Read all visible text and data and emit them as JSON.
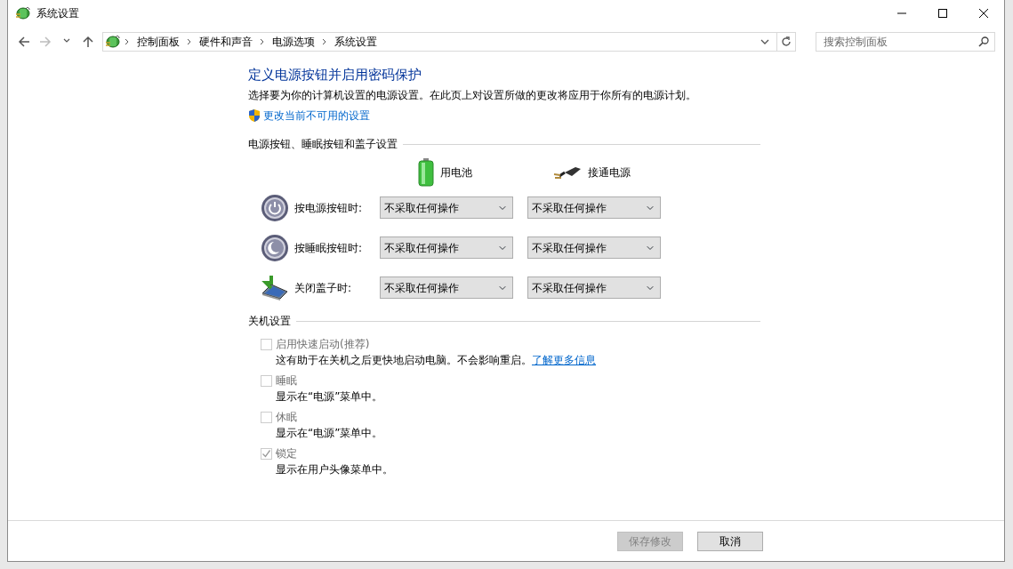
{
  "window": {
    "title": "系统设置"
  },
  "navigation": [
    {
      "kind": "back",
      "disabled": false
    },
    {
      "kind": "forward",
      "disabled": true
    },
    {
      "kind": "recent",
      "disabled": false
    },
    {
      "kind": "up",
      "disabled": false
    }
  ],
  "address_bar": {
    "path": [
      "控制面板",
      "硬件和声音",
      "电源选项",
      "系统设置"
    ]
  },
  "search": {
    "placeholder": "搜索控制面板"
  },
  "heading": "定义电源按钮并启用密码保护",
  "description": "选择要为你的计算机设置的电源设置。在此页上对设置所做的更改将应用于你所有的电源计划。",
  "admin_link": "更改当前不可用的设置",
  "button_section": {
    "title": "电源按钮、睡眠按钮和盖子设置",
    "columns": [
      {
        "label": "用电池",
        "kind": "battery"
      },
      {
        "label": "接通电源",
        "kind": "plug"
      }
    ],
    "rows": [
      {
        "label": "按电源按钮时:",
        "kind": "power",
        "values": [
          "不采取任何操作",
          "不采取任何操作"
        ]
      },
      {
        "label": "按睡眠按钮时:",
        "kind": "sleep",
        "values": [
          "不采取任何操作",
          "不采取任何操作"
        ]
      },
      {
        "label": "关闭盖子时:",
        "kind": "lid",
        "values": [
          "不采取任何操作",
          "不采取任何操作"
        ]
      }
    ]
  },
  "shutdown_section": {
    "title": "关机设置",
    "options": [
      {
        "label": "启用快速启动(推荐)",
        "checked": false,
        "disabled": true,
        "description": "这有助于在关机之后更快地启动电脑。不会影响重启。",
        "link": "了解更多信息"
      },
      {
        "label": "睡眠",
        "checked": false,
        "disabled": true,
        "description": "显示在“电源”菜单中。"
      },
      {
        "label": "休眠",
        "checked": false,
        "disabled": true,
        "description": "显示在“电源”菜单中。"
      },
      {
        "label": "锁定",
        "checked": true,
        "disabled": true,
        "description": "显示在用户头像菜单中。"
      }
    ]
  },
  "buttons": [
    {
      "label": "保存修改",
      "disabled": true
    },
    {
      "label": "取消",
      "disabled": false
    }
  ]
}
